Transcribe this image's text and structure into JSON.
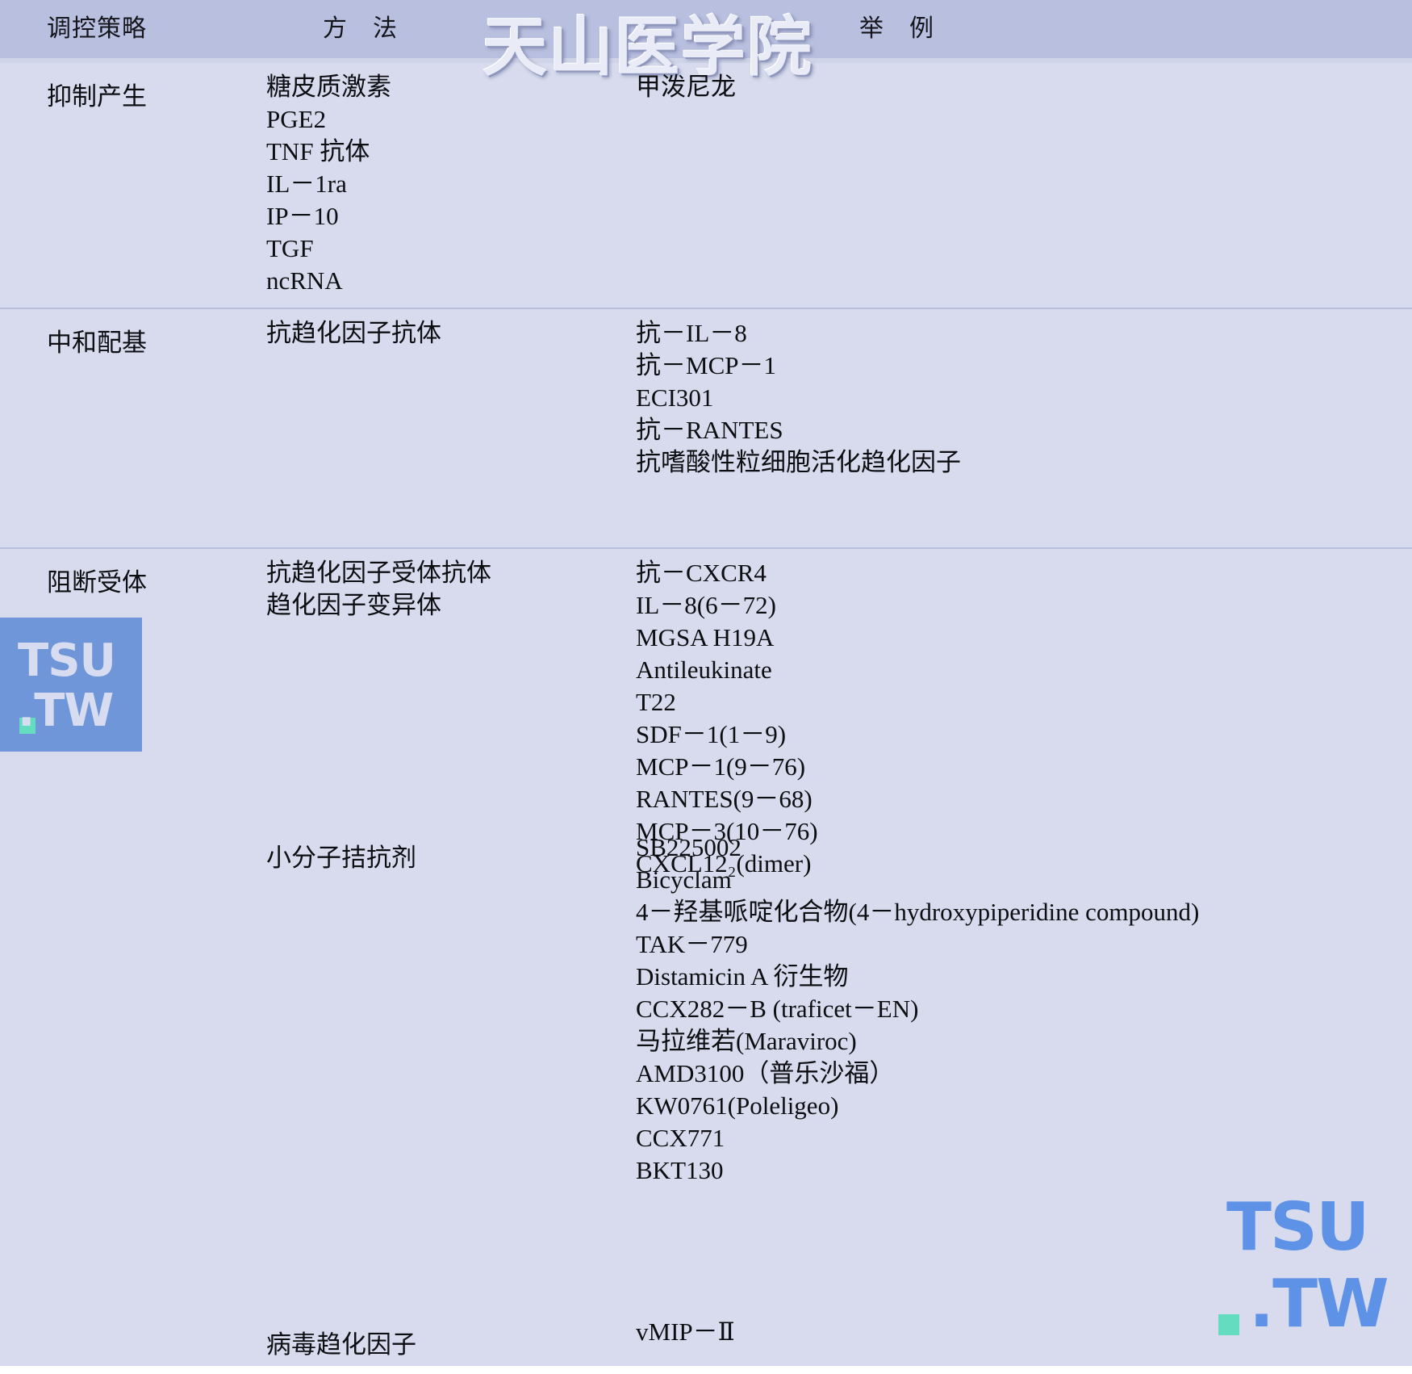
{
  "table": {
    "columns": [
      {
        "label": "调控策略"
      },
      {
        "label": "方　法"
      },
      {
        "label": "举　例"
      }
    ],
    "rows": [
      {
        "strategy": "抑制产生",
        "methods": [
          "糖皮质激素",
          "PGE2",
          "TNF 抗体",
          "IL－1ra",
          "IP－10",
          "TGF",
          "ncRNA"
        ],
        "examples": [
          "甲泼尼龙"
        ]
      },
      {
        "strategy": "中和配基",
        "methods": [
          "抗趋化因子抗体"
        ],
        "examples": [
          "抗－IL－8",
          "抗－MCP－1",
          "ECI301",
          "抗－RANTES",
          "抗嗜酸性粒细胞活化趋化因子"
        ]
      },
      {
        "strategy": "阻断受体",
        "methods_group_a": [
          "抗趋化因子受体抗体",
          "趋化因子变异体"
        ],
        "method_small_molecule": "小分子拮抗剂",
        "method_viral": "病毒趋化因子",
        "examples_group_a": [
          "抗－CXCR4",
          "IL－8(6－72)",
          "MGSA H19A",
          "Antileukinate",
          "T22",
          "SDF－1(1－9)",
          "MCP－1(9－76)",
          "RANTES(9－68)",
          "MCP－3(10－76)",
          "CXCL12₂(dimer)"
        ],
        "examples_small_molecule": [
          "SB225002",
          "Bicyclam",
          "4－羟基哌啶化合物(4－hydroxypiperidine compound)",
          "TAK－779",
          "Distamicin A 衍生物",
          "CCX282－B (traficet－EN)",
          "马拉维若(Maraviroc)",
          "AMD3100（普乐沙福）",
          "KW0761(Poleligeo)",
          "CCX771",
          "BKT130"
        ],
        "examples_viral": [
          "vMIP－Ⅱ"
        ]
      }
    ]
  },
  "watermarks": {
    "top_text": "天山医学院",
    "logo_line1": "TSU",
    "logo_line2": ".TW",
    "corner_line1": "TSU",
    "corner_line2": ".TW"
  },
  "colors": {
    "header_bg": "#b9bfdf",
    "body_bg": "#d7dbed",
    "rule": "#b7bddb",
    "logo_box": "#6e96d8",
    "logo_text": "#d8dcf0",
    "logo_dot": "#63dcc0",
    "corner_text": "#5e92e6",
    "text": "#0d0e12"
  }
}
